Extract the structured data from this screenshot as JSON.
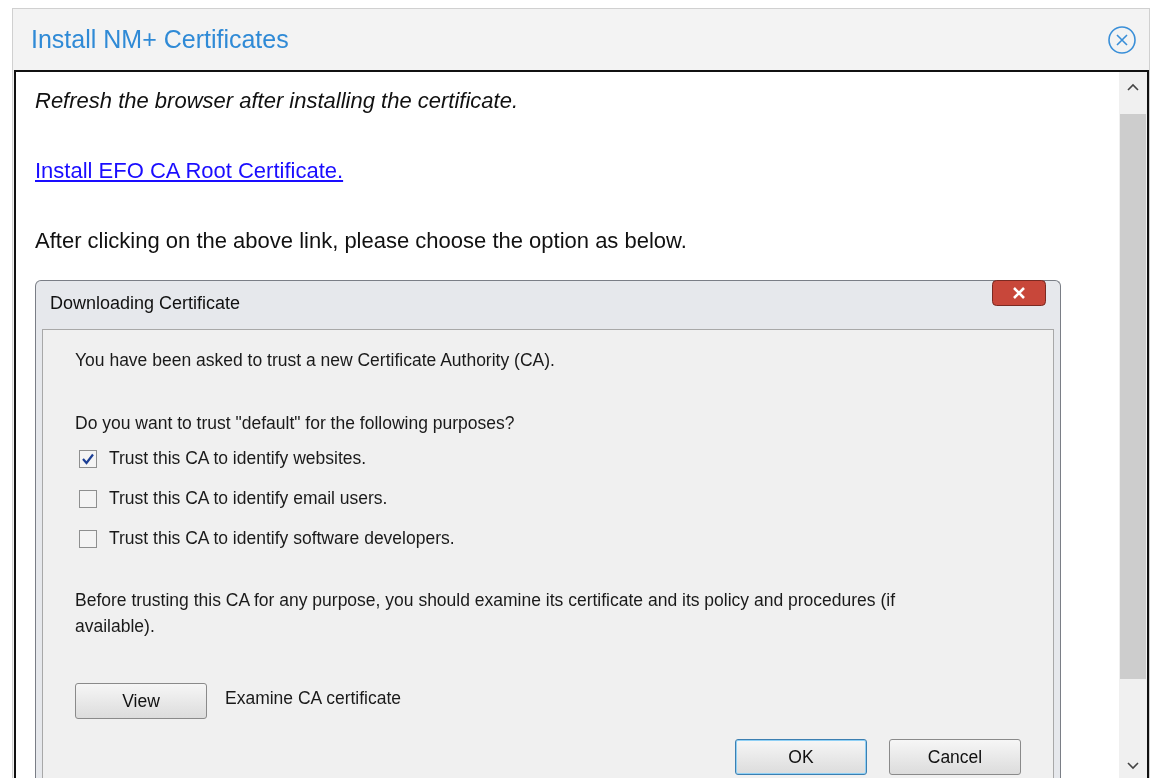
{
  "dialog": {
    "title": "Install NM+ Certificates"
  },
  "content": {
    "note": "Refresh the browser after installing the certificate.",
    "link": "Install EFO CA Root Certificate.",
    "instruction": "After clicking on the above link, please choose the option as below."
  },
  "screenshot": {
    "title": "Downloading Certificate",
    "intro": "You have been asked to trust a new Certificate Authority (CA).",
    "question": "Do you want to trust \"default\" for the following purposes?",
    "options": [
      {
        "label": "Trust this CA to identify websites.",
        "checked": true
      },
      {
        "label": "Trust this CA to identify email users.",
        "checked": false
      },
      {
        "label": "Trust this CA to identify software developers.",
        "checked": false
      }
    ],
    "warning": "Before trusting this CA for any purpose, you should examine its certificate and its policy and procedures (if available).",
    "view_button": "View",
    "view_label": "Examine CA certificate",
    "buttons": [
      {
        "label": "OK",
        "focused": true
      },
      {
        "label": "Cancel",
        "focused": false
      }
    ]
  }
}
